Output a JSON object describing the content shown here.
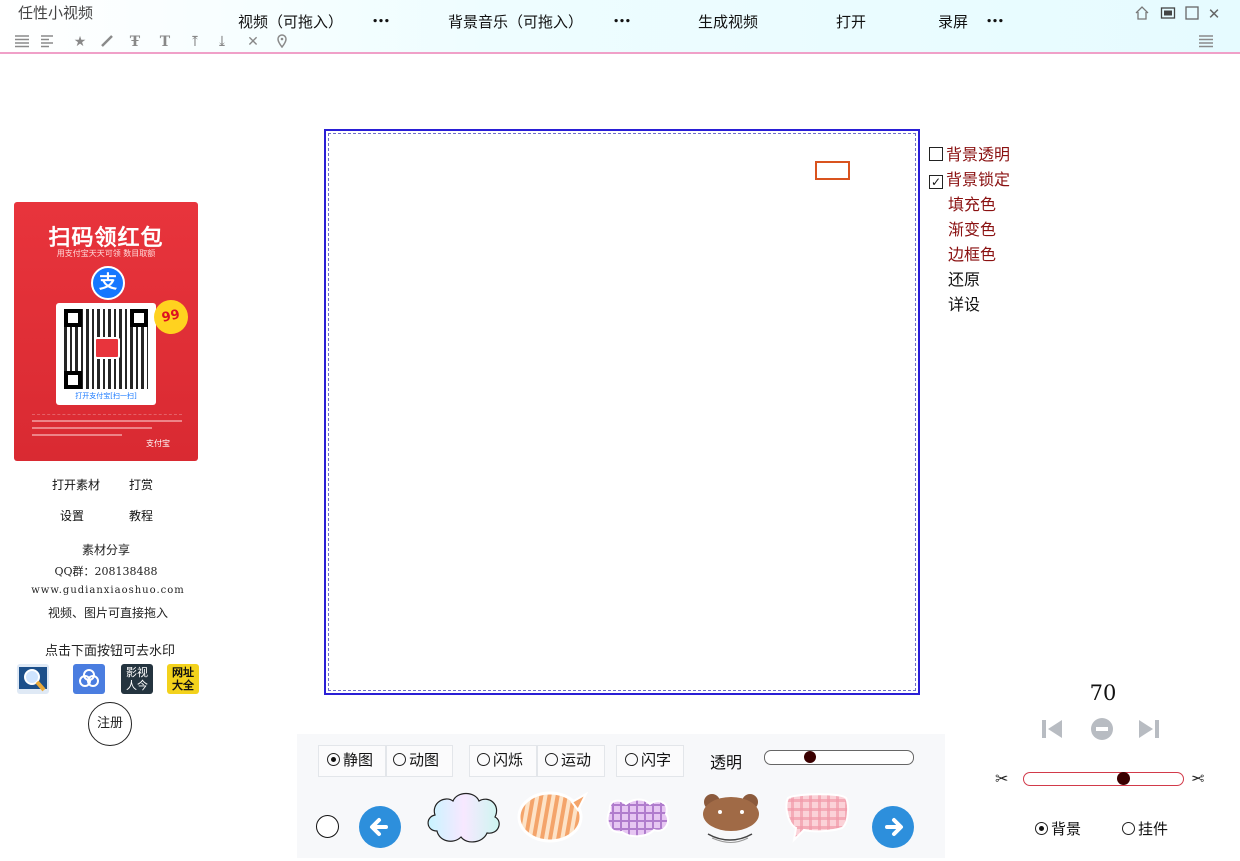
{
  "app": {
    "title": "任性小视频"
  },
  "menu": {
    "video": "视频（可拖入）",
    "video_more": "…",
    "music": "背景音乐（可拖入）",
    "music_more": "…",
    "generate": "生成视频",
    "open": "打开",
    "record": "录屏",
    "record_more": "…"
  },
  "toolbar_icons": [
    "align-justify-icon",
    "align-left-icon",
    "star-icon",
    "brush-icon",
    "text-outline-icon",
    "text-icon",
    "text-up-icon",
    "text-down-icon",
    "close-icon",
    "location-pin-icon"
  ],
  "window_icons": [
    "home-icon",
    "restore-icon",
    "maximize-icon",
    "close-icon"
  ],
  "promo": {
    "title": "扫码领红包",
    "subtitle": "用支付宝天天可领 数目取额",
    "logo": "支",
    "caption": "打开支付宝[扫一扫]",
    "badge": "99",
    "brand": "支付宝"
  },
  "left_links": {
    "open_material": "打开素材",
    "reward": "打赏",
    "settings": "设置",
    "tutorial": "教程"
  },
  "left_info": {
    "share": "素材分享",
    "qq_group": "QQ群：208138488",
    "website": "www.gudianxiaoshuo.com",
    "drag_hint": "视频、图片可直接拖入",
    "watermark_hint": "点击下面按钮可去水印",
    "watermark_icon_label_3": "影视人今",
    "watermark_icon_label_4": "网址大全",
    "register": "注册"
  },
  "background_menu": {
    "transparent": "背景透明",
    "transparent_checked": false,
    "lock": "背景锁定",
    "lock_checked": true,
    "fill": "填充色",
    "gradient": "渐变色",
    "border": "边框色",
    "restore": "还原",
    "details": "详设"
  },
  "playback": {
    "speed": "70",
    "trim_position": 0.64
  },
  "layer": {
    "background": "背景",
    "pendant": "挂件",
    "selected": "background"
  },
  "bottom": {
    "static": "静图",
    "animated": "动图",
    "blink": "闪烁",
    "motion": "运动",
    "flash_text": "闪字",
    "selected_mode": "static",
    "opacity_label": "透明",
    "opacity_position": 0.29
  },
  "stickers": [
    "cloud-bubble",
    "striped-oval-bubble",
    "plaid-purple-bubble",
    "bear-bubble",
    "pink-plaid-bubble"
  ],
  "colors": {
    "topbar_border": "#f0a0c8",
    "canvas_border": "#2a1fd6",
    "selection": "#d9531e",
    "menu_text": "#8a1111",
    "arrow": "#2d8fdc",
    "trim_track": "#d23a4a"
  }
}
